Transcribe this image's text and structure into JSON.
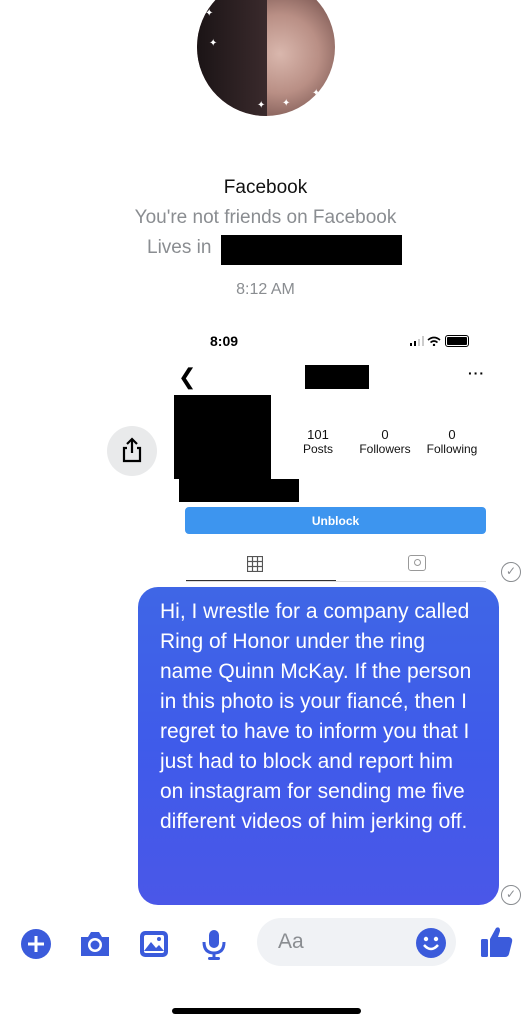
{
  "profile": {
    "name": "Facebook",
    "friend_status": "You're not friends on Facebook",
    "lives_label": "Lives in",
    "timestamp": "8:12 AM"
  },
  "embedded": {
    "status_time": "8:09",
    "stats": [
      {
        "value": "101",
        "label": "Posts"
      },
      {
        "value": "0",
        "label": "Followers"
      },
      {
        "value": "0",
        "label": "Following"
      }
    ],
    "unblock_label": "Unblock"
  },
  "message": {
    "text": "Hi, I wrestle for a company called Ring of Honor under the ring name Quinn McKay. If the person in this photo is your fiancé, then I regret to have to inform you that I just had to block and report him on instagram for sending me five different videos of him jerking off."
  },
  "composer": {
    "placeholder": "Aa"
  },
  "colors": {
    "accent": "#3b5bdb",
    "bubble": "#4160e6",
    "unblock": "#3d95ef",
    "muted_text": "#8a8d91"
  },
  "icons": [
    "share-icon",
    "back-chevron-icon",
    "more-icon",
    "grid-icon",
    "tagged-icon",
    "plus-icon",
    "camera-icon",
    "gallery-icon",
    "mic-icon",
    "emoji-icon",
    "like-icon",
    "seen-check-icon"
  ]
}
